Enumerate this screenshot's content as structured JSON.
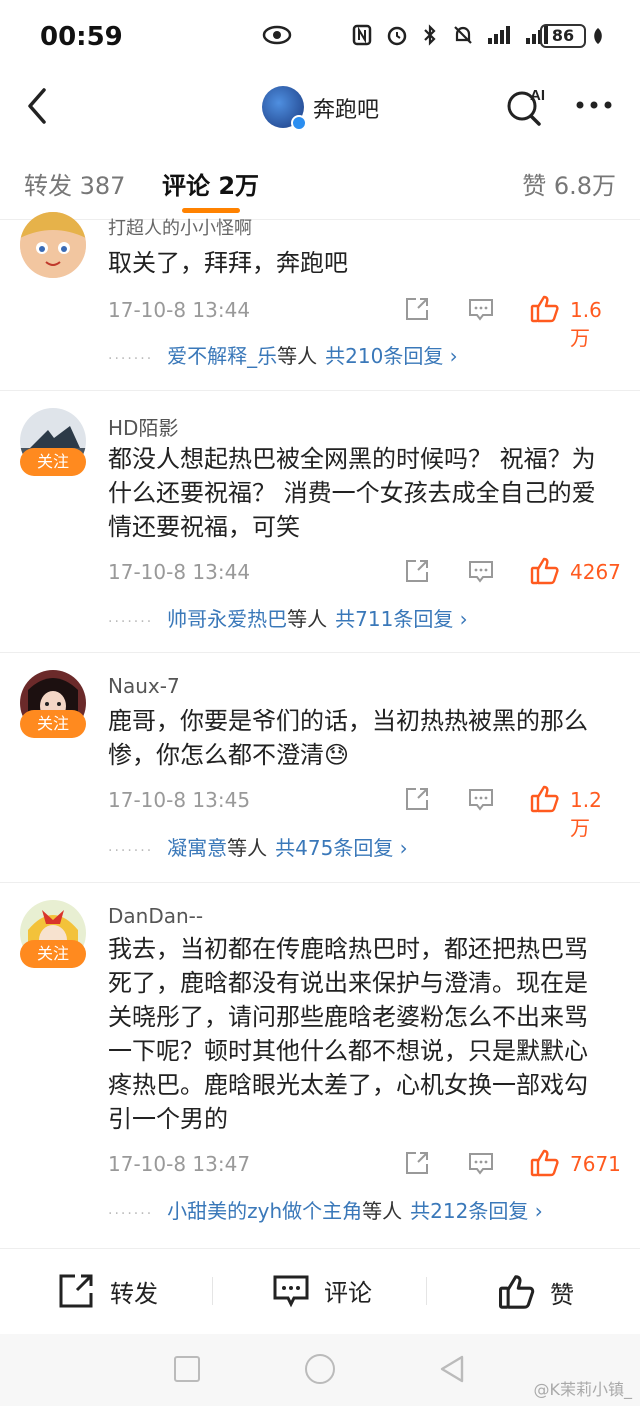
{
  "status": {
    "time": "00:59",
    "battery": "86"
  },
  "header": {
    "title": "奔跑吧"
  },
  "tabs": {
    "repost": "转发 387",
    "comment": "评论 2万",
    "like": "赞 6.8万"
  },
  "colors": {
    "accent": "#ff8200",
    "link": "#3a78b9",
    "like": "#ff5a1f"
  },
  "comments": [
    {
      "user": "打超人的小小怪啊",
      "text": "取关了，拜拜，奔跑吧",
      "date": "17-10-8 13:44",
      "likes": "1.6万",
      "reply_names": "爱不解释_乐",
      "reply_suffix": "等人",
      "reply_count": "共210条回复 ›",
      "follow": ""
    },
    {
      "user": "HD陌影",
      "text": "都没人想起热巴被全网黑的时候吗？ 祝福？为什么还要祝福？ 消费一个女孩去成全自己的爱情还要祝福，可笑",
      "date": "17-10-8 13:44",
      "likes": "4267",
      "reply_names": "帅哥永爱热巴",
      "reply_suffix": "等人",
      "reply_count": "共711条回复 ›",
      "follow": "关注"
    },
    {
      "user": "Naux-7",
      "text": "鹿哥，你要是爷们的话，当初热热被黑的那么惨，你怎么都不澄清😓",
      "date": "17-10-8 13:45",
      "likes": "1.2万",
      "reply_names": "凝寓意",
      "reply_suffix": "等人",
      "reply_count": "共475条回复 ›",
      "follow": "关注"
    },
    {
      "user": "DanDan--",
      "text": "我去，当初都在传鹿晗热巴时，都还把热巴骂死了，鹿晗都没有说出来保护与澄清。现在是关晓彤了，请问那些鹿晗老婆粉怎么不出来骂一下呢？顿时其他什么都不想说，只是默默心疼热巴。鹿晗眼光太差了，心机女换一部戏勾引一个男的",
      "date": "17-10-8 13:47",
      "likes": "7671",
      "reply_names": "小甜美的zyh做个主角",
      "reply_suffix": "等人",
      "reply_count": "共212条回复 ›",
      "follow": "关注"
    }
  ],
  "actions": {
    "repost": "转发",
    "comment": "评论",
    "like": "赞"
  },
  "watermark": "@K茉莉小镇_",
  "icons": [
    "eye-icon",
    "nfc-icon",
    "alarm-icon",
    "bluetooth-icon",
    "mute-icon",
    "signal-icon",
    "back-icon",
    "ai-search-icon",
    "more-icon",
    "share-icon",
    "reply-icon",
    "thumbs-up-icon"
  ]
}
